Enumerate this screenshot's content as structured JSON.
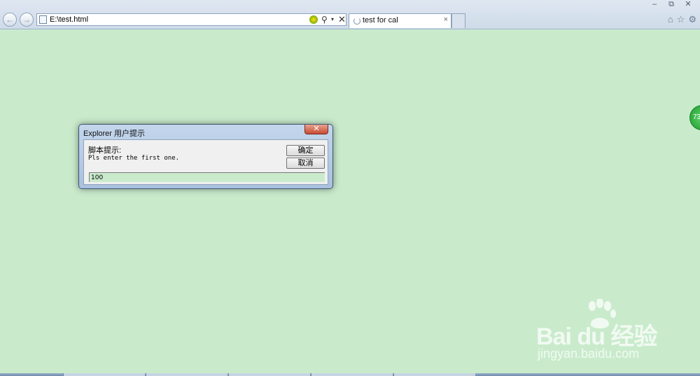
{
  "browser": {
    "address": "E:\\test.html",
    "tab_title": "test for cal",
    "tab_close": "×",
    "back_glyph": "←",
    "forward_glyph": "→",
    "search_glyph": "⚲",
    "dropdown_glyph": "▾",
    "stop_glyph": "✕",
    "window_minimize": "–",
    "window_restore": "⧉",
    "window_close": "✕",
    "toolbar_icons": [
      "home-icon",
      "favorites-star-icon",
      "tools-gear-icon"
    ],
    "home_glyph": "⌂",
    "star_glyph": "☆",
    "gear_glyph": "⚙"
  },
  "page": {
    "background": "#c9ebcc",
    "side_badge_text": "73"
  },
  "dialog": {
    "title": "Explorer 用户提示",
    "close_glyph": "✕",
    "label": "脚本提示:",
    "message": "Pls enter the first one.",
    "ok_label": "确定",
    "cancel_label": "取消",
    "input_value": "100"
  },
  "watermark": {
    "brand": "Bai du 经验",
    "url": "jingyan.baidu.com"
  },
  "colors": {
    "dialog_close_red": "#c74a32",
    "chrome_blue": "#cfdbe9",
    "badge_green": "#1e9a2f"
  }
}
